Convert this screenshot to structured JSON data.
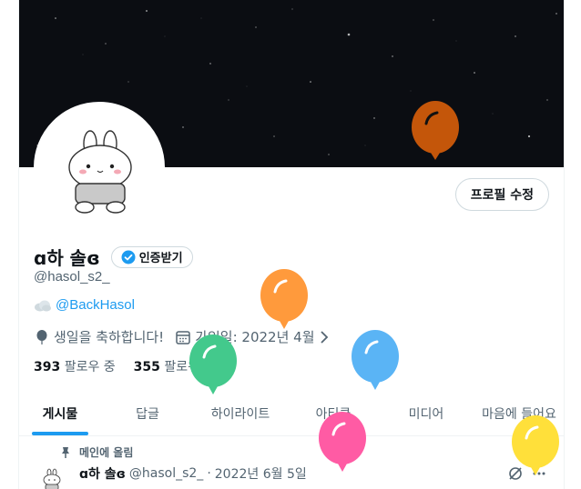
{
  "profile": {
    "display_name": "ɑ하 솔ɞ",
    "verify_label": "인증받기",
    "handle": "@hasol_s2_",
    "bio_link": "@BackHasol",
    "birthday_text": "생일을 축하합니다!",
    "joined_text": "가입일: 2022년 4월",
    "following_count": "393",
    "following_label": "팔로우 중",
    "followers_count": "355",
    "followers_label": "팔로워"
  },
  "edit_profile_label": "프로필 수정",
  "tabs": [
    {
      "label": "게시물",
      "active": true
    },
    {
      "label": "답글",
      "active": false
    },
    {
      "label": "하이라이트",
      "active": false
    },
    {
      "label": "아티클",
      "active": false
    },
    {
      "label": "미디어",
      "active": false
    },
    {
      "label": "마음에 들어요",
      "active": false
    }
  ],
  "pinned_label": "메인에 올림",
  "tweet": {
    "name": "ɑ하 솔ɞ",
    "handle": "@hasol_s2_",
    "separator": "·",
    "date": "2022년 6월 5일"
  },
  "icons": {
    "verify": "verified-badge-icon",
    "cloud": "cloud-emoji-icon",
    "birthday": "balloon-pin-icon",
    "calendar": "calendar-icon",
    "chevron": "chevron-right-icon",
    "pin": "pin-icon",
    "more": "more-icon",
    "grok": "grok-icon"
  },
  "colors": {
    "accent": "#1d9bf0",
    "banner": "#0b0d12",
    "balloon_orange_dark": "#c4560a",
    "balloon_orange": "#ff9a3c",
    "balloon_green": "#43c98c",
    "balloon_blue": "#5ab4f5",
    "balloon_pink": "#ff5ba4",
    "balloon_yellow": "#ffe03a"
  }
}
